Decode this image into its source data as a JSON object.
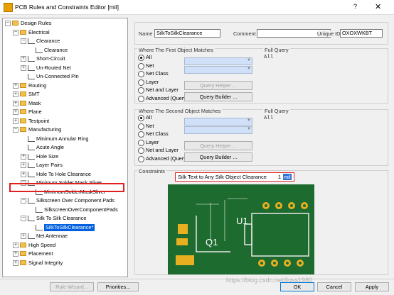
{
  "window": {
    "title": "PCB Rules and Constraints Editor [mil]",
    "help": "?",
    "close": "✕"
  },
  "tree": [
    {
      "label": "Design Rules",
      "indent": 0,
      "exp": "-",
      "icon": "folder"
    },
    {
      "label": "Electrical",
      "indent": 1,
      "exp": "-",
      "icon": "folder"
    },
    {
      "label": "Clearance",
      "indent": 2,
      "exp": "-",
      "icon": "rule"
    },
    {
      "label": "Clearance",
      "indent": 3,
      "exp": "",
      "icon": "rule"
    },
    {
      "label": "Short-Circuit",
      "indent": 2,
      "exp": "+",
      "icon": "rule"
    },
    {
      "label": "Un-Routed Net",
      "indent": 2,
      "exp": "+",
      "icon": "rule"
    },
    {
      "label": "Un-Connected Pin",
      "indent": 2,
      "exp": "",
      "icon": "rule"
    },
    {
      "label": "Routing",
      "indent": 1,
      "exp": "+",
      "icon": "folder"
    },
    {
      "label": "SMT",
      "indent": 1,
      "exp": "+",
      "icon": "folder"
    },
    {
      "label": "Mask",
      "indent": 1,
      "exp": "+",
      "icon": "folder"
    },
    {
      "label": "Plane",
      "indent": 1,
      "exp": "+",
      "icon": "folder"
    },
    {
      "label": "Testpoint",
      "indent": 1,
      "exp": "+",
      "icon": "folder"
    },
    {
      "label": "Manufacturing",
      "indent": 1,
      "exp": "-",
      "icon": "folder"
    },
    {
      "label": "Minimum Annular Ring",
      "indent": 2,
      "exp": "",
      "icon": "rule"
    },
    {
      "label": "Acute Angle",
      "indent": 2,
      "exp": "",
      "icon": "rule"
    },
    {
      "label": "Hole Size",
      "indent": 2,
      "exp": "+",
      "icon": "rule"
    },
    {
      "label": "Layer Pairs",
      "indent": 2,
      "exp": "+",
      "icon": "rule"
    },
    {
      "label": "Hole To Hole Clearance",
      "indent": 2,
      "exp": "+",
      "icon": "rule"
    },
    {
      "label": "Minimum Solder Mask Sliver",
      "indent": 2,
      "exp": "-",
      "icon": "rule"
    },
    {
      "label": "MinimumSolderMaskSliver",
      "indent": 3,
      "exp": "",
      "icon": "rule"
    },
    {
      "label": "Silkscreen Over Component Pads",
      "indent": 2,
      "exp": "-",
      "icon": "rule"
    },
    {
      "label": "SilkscreenOverComponentPads",
      "indent": 3,
      "exp": "",
      "icon": "rule"
    },
    {
      "label": "Silk To Silk Clearance",
      "indent": 2,
      "exp": "-",
      "icon": "rule"
    },
    {
      "label": "SilkToSilkClearance*",
      "indent": 3,
      "exp": "",
      "icon": "rule",
      "selected": true
    },
    {
      "label": "Net Antennae",
      "indent": 2,
      "exp": "+",
      "icon": "rule"
    },
    {
      "label": "High Speed",
      "indent": 1,
      "exp": "+",
      "icon": "folder"
    },
    {
      "label": "Placement",
      "indent": 1,
      "exp": "+",
      "icon": "folder"
    },
    {
      "label": "Signal Integrity",
      "indent": 1,
      "exp": "+",
      "icon": "folder"
    }
  ],
  "rule": {
    "name_label": "Name",
    "name_value": "SilkToSilkClearance",
    "comment_label": "Comment",
    "comment_value": "",
    "uid_label": "Unique ID",
    "uid_value": "OXOXWKBT"
  },
  "first": {
    "title": "Where The First Object Matches",
    "options": [
      "All",
      "Net",
      "Net Class",
      "Layer",
      "Net and Layer",
      "Advanced (Query)"
    ],
    "query_helper": "Query Helper ...",
    "query_builder": "Query Builder ...",
    "full_query_label": "Full Query",
    "full_query_value": "All"
  },
  "second": {
    "title": "Where The Second Object Matches",
    "options": [
      "All",
      "Net",
      "Net Class",
      "Layer",
      "Net and Layer",
      "Advanced (Query)"
    ],
    "query_helper": "Query Helper ...",
    "query_builder": "Query Builder ...",
    "full_query_label": "Full Query",
    "full_query_value": "All"
  },
  "constraints": {
    "title": "Constraints",
    "label": "Silk Text to Any Silk Object Clearance",
    "value": "1",
    "unit": "mil",
    "board_labels": {
      "q1": "Q1",
      "u1": "U1"
    }
  },
  "footer": {
    "rule_wizard": "Rule Wizard...",
    "priorities": "Priorities...",
    "ok": "OK",
    "cancel": "Cancel",
    "apply": "Apply",
    "watermark": "https://blog.csdn.net/liuss1980"
  },
  "colors": {
    "board": "#1d6b2f",
    "pad": "#e8b020",
    "accent": "#0060df",
    "highlight": "#e02020"
  }
}
